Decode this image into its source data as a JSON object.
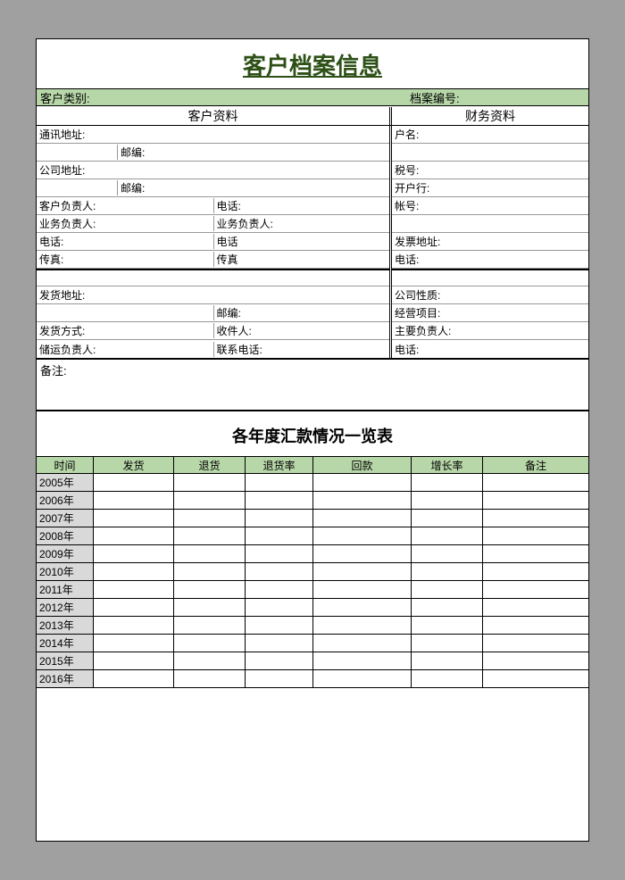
{
  "title": "客户档案信息",
  "header": {
    "category_label": "客户类别:",
    "file_no_label": "档案编号:"
  },
  "sections": {
    "customer": "客户资料",
    "finance": "财务资料"
  },
  "customer": {
    "addr": "通讯地址:",
    "zip": "邮编:",
    "co_addr": "公司地址:",
    "zip2": "邮编:",
    "cust_mgr": "客户负责人:",
    "phone": "电话:",
    "biz_mgr": "业务负责人:",
    "biz_mgr2": "业务负责人:",
    "phone2": "电话:",
    "phone3": "电话",
    "fax": "传真:",
    "fax2": "传真",
    "ship_addr": "发货地址:",
    "zip3": "邮编:",
    "ship_method": "发货方式:",
    "receiver": "收件人:",
    "logistics_mgr": "储运负责人:",
    "contact_phone": "联系电话:"
  },
  "finance": {
    "account_name": "户名:",
    "tax_id": "税号:",
    "bank": "开户行:",
    "account_no": "帐号:",
    "invoice_addr": "发票地址:",
    "phone": "电话:",
    "company_nature": "公司性质:",
    "biz_items": "经营项目:",
    "main_mgr": "主要负责人:",
    "phone2": "电话:"
  },
  "remarks_label": "备注:",
  "subtitle": "各年度汇款情况一览表",
  "columns": {
    "time": "时间",
    "ship": "发货",
    "return": "退货",
    "return_rate": "退货率",
    "payment": "回款",
    "growth": "增长率",
    "note": "备注"
  },
  "years": [
    "2005年",
    "2006年",
    "2007年",
    "2008年",
    "2009年",
    "2010年",
    "2011年",
    "2012年",
    "2013年",
    "2014年",
    "2015年",
    "2016年"
  ]
}
